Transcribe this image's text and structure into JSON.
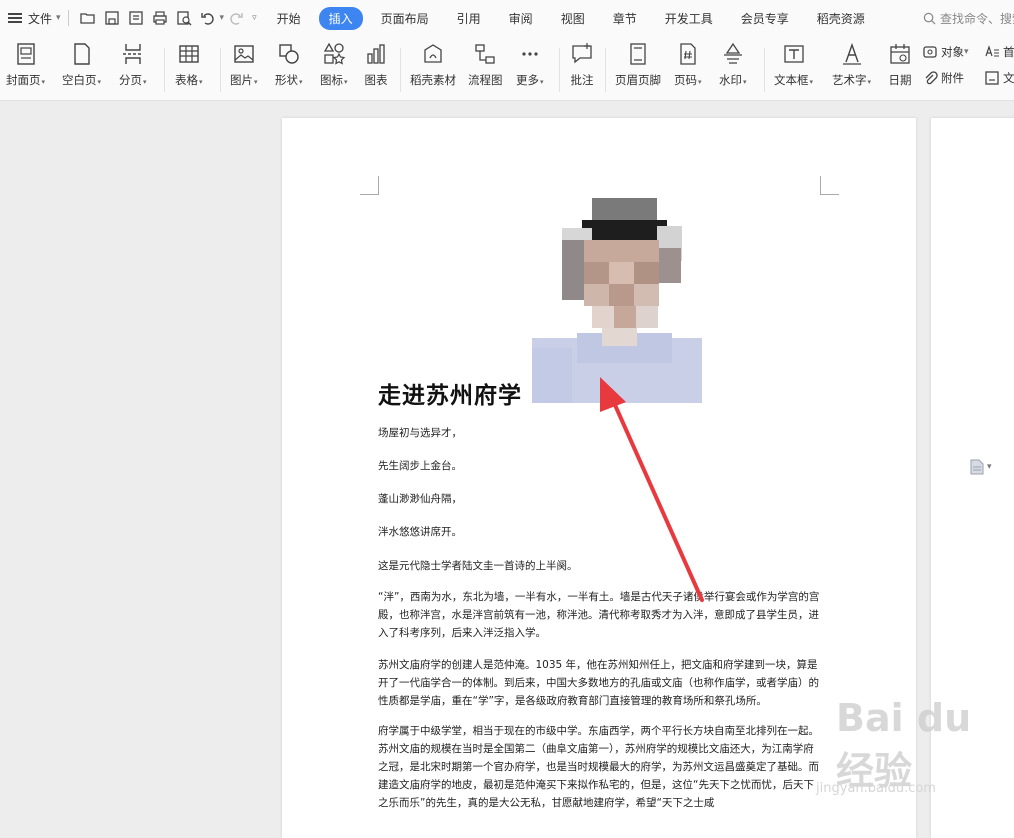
{
  "menubar": {
    "file_label": "文件",
    "tabs": [
      "开始",
      "插入",
      "页面布局",
      "引用",
      "审阅",
      "视图",
      "章节",
      "开发工具",
      "会员专享",
      "稻壳资源"
    ],
    "active_tab": "插入",
    "search_placeholder": "查找命令、搜索"
  },
  "ribbon": {
    "cover_page": "封面页",
    "blank_page": "空白页",
    "page_break": "分页",
    "table": "表格",
    "picture": "图片",
    "shape": "形状",
    "icon": "图标",
    "chart": "图表",
    "docer_material": "稻壳素材",
    "flowchart": "流程图",
    "more": "更多",
    "comment": "批注",
    "header_footer": "页眉页脚",
    "page_number": "页码",
    "watermark": "水印",
    "text_box": "文本框",
    "word_art": "艺术字",
    "date": "日期",
    "object": "对象",
    "attachment": "附件",
    "first_letter": "首",
    "doc_part": "文"
  },
  "document": {
    "title": "走进苏州府学",
    "lines": [
      "场屋初与选异才，",
      "先生阔步上金台。",
      "蓬山渺渺仙舟隔，",
      "泮水悠悠讲席开。",
      "这是元代隐士学者陆文圭一首诗的上半阕。"
    ],
    "paragraphs": [
      "“泮”，西南为水，东北为墙，一半有水，一半有土。墙是古代天子诸侯举行宴会或作为学宫的宫殿，也称泮宫，水是泮宫前筑有一池，称泮池。清代称考取秀才为入泮，意即成了县学生员，进入了科考序列，后来入泮泛指入学。",
      "苏州文庙府学的创建人是范仲淹。1035 年，他在苏州知州任上，把文庙和府学建到一块，算是开了一代庙学合一的体制。到后来，中国大多数地方的孔庙或文庙（也称作庙学，或者学庙）的性质都是学庙，重在“学”字，是各级政府教育部门直接管理的教育场所和祭孔场所。",
      "府学属于中级学堂，相当于现在的市级中学。东庙西学，两个平行长方块自南至北排列在一起。苏州文庙的规模在当时是全国第二（曲阜文庙第一），苏州府学的规模比文庙还大，为江南学府之冠，是北宋时期第一个官办府学，也是当时规模最大的府学，为苏州文运昌盛奠定了基础。而建造文庙府学的地皮，最初是范仲淹买下来拟作私宅的，但是，这位“先天下之忧而忧，后天下之乐而乐”的先生，真的是大公无私，甘愿献地建府学，希望“天下之士咸"
    ]
  },
  "watermark": {
    "text": "Bai du 经验",
    "url": "jingyan.baidu.com"
  },
  "colors": {
    "accent": "#3d86f2",
    "arrow": "#e8393f"
  }
}
